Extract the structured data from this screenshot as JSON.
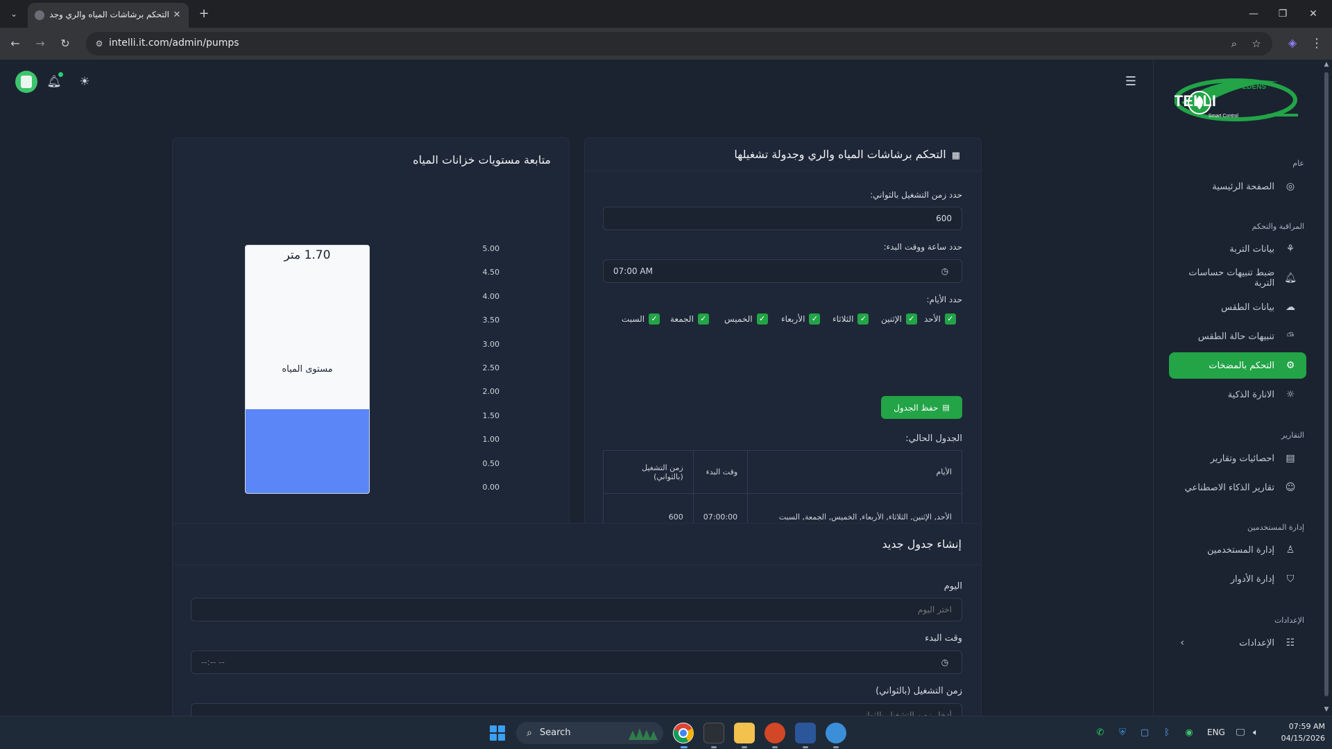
{
  "browser": {
    "tab_title": "التحكم برشاشات المياه والري وجدو",
    "url": "intelli.it.com/admin/pumps",
    "close_glyph": "✕",
    "new_tab_glyph": "+"
  },
  "topbar": {
    "icons": [
      "avatar-icon",
      "bell-icon",
      "sun-icon",
      "menu-icon"
    ]
  },
  "sidebar": {
    "logo": {
      "brand": "INTELLI",
      "sub_brand": "EDENS",
      "tagline": "Smart Control"
    },
    "sections": [
      {
        "label": "عام",
        "items": [
          {
            "label": "الصفحة الرئيسية",
            "icon": "dashboard-icon"
          }
        ]
      },
      {
        "label": "المراقبة والتحكم",
        "items": [
          {
            "label": "بيانات التربة",
            "icon": "sprout-icon"
          },
          {
            "label": "ضبط تنبيهات حساسات التربة",
            "icon": "bell-icon"
          },
          {
            "label": "بيانات الطقس",
            "icon": "cloud-icon"
          },
          {
            "label": "تنبيهات حالة الطقس",
            "icon": "cloud-alert-icon"
          },
          {
            "label": "التحكم بالمضخات",
            "icon": "pump-icon",
            "active": true
          },
          {
            "label": "الانارة الذكية",
            "icon": "bulb-icon"
          }
        ]
      },
      {
        "label": "التقارير",
        "items": [
          {
            "label": "احصائيات وتقارير",
            "icon": "clipboard-icon"
          },
          {
            "label": "تقارير الذكاء الاصطناعي",
            "icon": "robot-icon"
          }
        ]
      },
      {
        "label": "إدارة المستخدمين",
        "items": [
          {
            "label": "إدارة المستخدمين",
            "icon": "user-icon"
          },
          {
            "label": "إدارة الأدوار",
            "icon": "shield-icon"
          }
        ]
      },
      {
        "label": "الإعدادات",
        "items": [
          {
            "label": "الإعدادات",
            "icon": "settings-icon"
          }
        ]
      }
    ]
  },
  "control_card": {
    "title": "التحكم برشاشات المياه والري وجدولة تشغيلها",
    "duration_label": "حدد زمن التشغيل بالثواني:",
    "duration_value": "600",
    "start_label": "حدد ساعة ووقت البدء:",
    "start_value": "07:00 AM",
    "days_label": "حدد الأيام:",
    "days": [
      {
        "label": "الأحد",
        "checked": true
      },
      {
        "label": "الإثنين",
        "checked": true
      },
      {
        "label": "الثلاثاء",
        "checked": true
      },
      {
        "label": "الأربعاء",
        "checked": true
      },
      {
        "label": "الخميس",
        "checked": true
      },
      {
        "label": "الجمعة",
        "checked": true
      },
      {
        "label": "السبت",
        "checked": true
      }
    ],
    "save_button": "حفظ الجدول",
    "current_schedule_label": "الجدول الحالي:",
    "table": {
      "headers": [
        "الأيام",
        "وقت البدء",
        "زمن التشغيل (بالثواني)"
      ],
      "rows": [
        [
          "الأحد, الإثنين, الثلاثاء, الأربعاء, الخميس, الجمعة, السبت",
          "07:00:00",
          "600"
        ]
      ]
    }
  },
  "tank_card": {
    "title": "متابعة مستويات خزانات المياه",
    "level_text": "1.70 متر",
    "bar_label": "مستوى المياه",
    "colors": {
      "fill": "#5b86f8",
      "empty": "#f8f9fb"
    }
  },
  "chart_data": {
    "type": "bar",
    "categories": [
      "مستوى المياه"
    ],
    "values": [
      1.7
    ],
    "ylim": [
      0,
      5
    ],
    "yticks": [
      "5.00",
      "4.50",
      "4.00",
      "3.50",
      "3.00",
      "2.50",
      "2.00",
      "1.50",
      "1.00",
      "0.50",
      "0.00"
    ],
    "title": "متابعة مستويات خزانات المياه",
    "xlabel": "",
    "ylabel": ""
  },
  "new_schedule_card": {
    "title": "إنشاء جدول جديد",
    "day_label": "اليوم",
    "day_placeholder": "اختر اليوم",
    "start_label": "وقت البدء",
    "start_placeholder": "--:-- --",
    "duration_label": "زمن التشغيل (بالثواني)",
    "duration_placeholder": "أدخل زمن التشغيل بالثواني"
  },
  "taskbar": {
    "search_text": "Search",
    "lang": "ENG",
    "time": "07:59 AM",
    "date": "04/15/2026"
  },
  "colors": {
    "accent": "#22a447",
    "background": "#1b2331",
    "card": "#1e2737"
  }
}
